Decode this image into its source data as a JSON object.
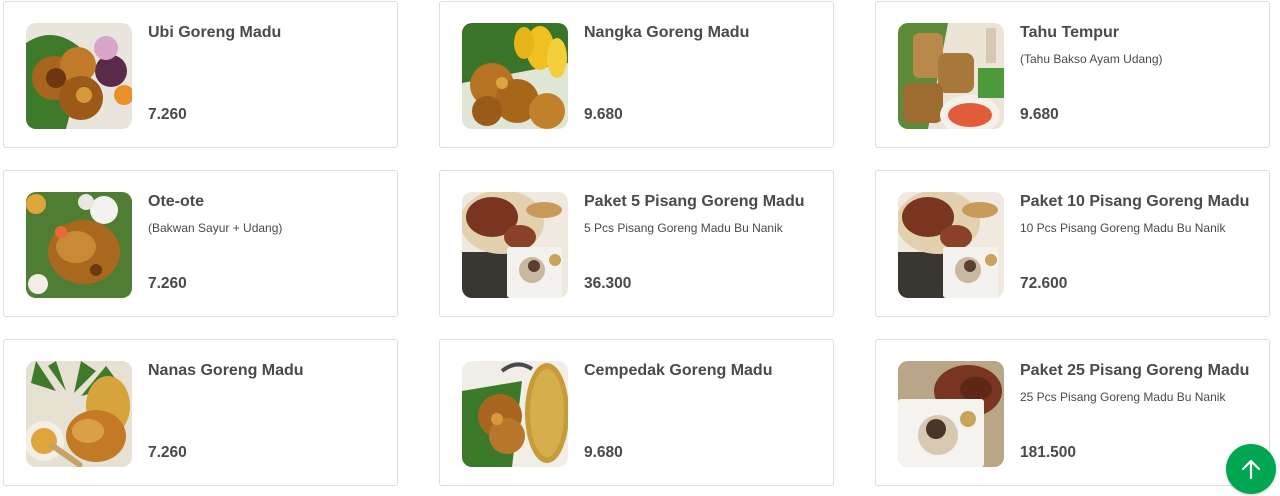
{
  "menu": {
    "items": [
      {
        "name": "Ubi Goreng Madu",
        "description": "",
        "price": "7.260",
        "image": "ubi-goreng-image"
      },
      {
        "name": "Nangka Goreng Madu",
        "description": "",
        "price": "9.680",
        "image": "nangka-goreng-image"
      },
      {
        "name": "Tahu Tempur",
        "description": "(Tahu Bakso Ayam Udang)",
        "price": "9.680",
        "image": "tahu-tempur-image"
      },
      {
        "name": "Ote-ote",
        "description": "(Bakwan Sayur + Udang)",
        "price": "7.260",
        "image": "ote-ote-image"
      },
      {
        "name": "Paket 5 Pisang Goreng Madu",
        "description": "5 Pcs Pisang Goreng Madu Bu Nanik",
        "price": "36.300",
        "image": "pisang-paket-image"
      },
      {
        "name": "Paket 10 Pisang Goreng Madu",
        "description": "10 Pcs Pisang Goreng Madu Bu Nanik",
        "price": "72.600",
        "image": "pisang-paket-image"
      },
      {
        "name": "Nanas Goreng Madu",
        "description": "",
        "price": "7.260",
        "image": "nanas-goreng-image"
      },
      {
        "name": "Cempedak Goreng Madu",
        "description": "",
        "price": "9.680",
        "image": "cempedak-goreng-image"
      },
      {
        "name": "Paket 25 Pisang Goreng Madu",
        "description": "25 Pcs Pisang Goreng Madu Bu Nanik",
        "price": "181.500",
        "image": "pisang-box-image"
      }
    ]
  },
  "scroll_top": {
    "icon": "arrow-up-icon",
    "color": "#00a651"
  }
}
